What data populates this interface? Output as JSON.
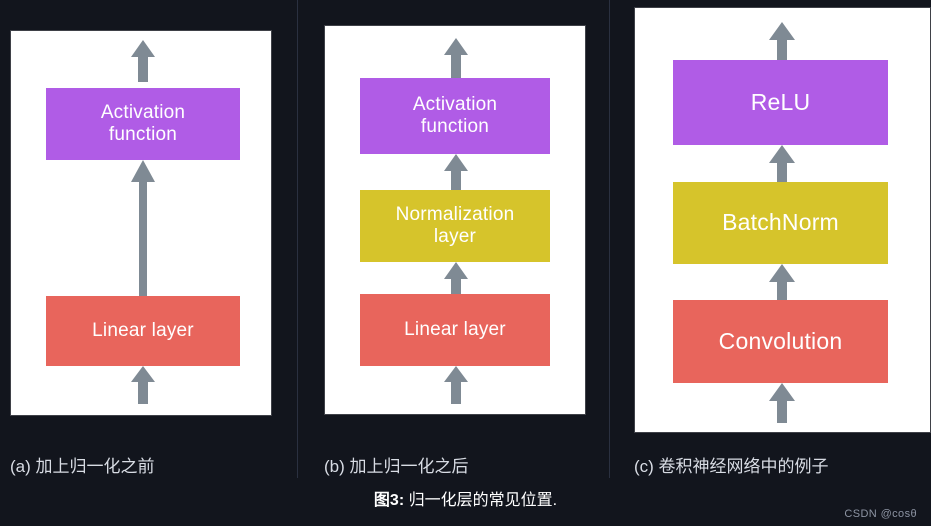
{
  "figure": {
    "caption_number": "图3:",
    "caption_text": " 归一化层的常见位置.",
    "watermark": "CSDN @cosθ"
  },
  "colors": {
    "background": "#12151d",
    "card": "#ffffff",
    "purple": "#b05ce6",
    "yellow": "#d6c42b",
    "red": "#e8655c",
    "arrow": "#7f8a94",
    "divider": "#2a3040",
    "label_text": "#d8dce4"
  },
  "panels": [
    {
      "id": "a",
      "label": "(a) 加上归一化之前",
      "nodes": [
        {
          "text": "Activation\nfunction",
          "color": "purple"
        },
        {
          "text": "Linear layer",
          "color": "red"
        }
      ]
    },
    {
      "id": "b",
      "label": "(b) 加上归一化之后",
      "nodes": [
        {
          "text": "Activation\nfunction",
          "color": "purple"
        },
        {
          "text": "Normalization\nlayer",
          "color": "yellow"
        },
        {
          "text": "Linear layer",
          "color": "red"
        }
      ]
    },
    {
      "id": "c",
      "label": "(c) 卷积神经网络中的例子",
      "nodes": [
        {
          "text": "ReLU",
          "color": "purple"
        },
        {
          "text": "BatchNorm",
          "color": "yellow"
        },
        {
          "text": "Convolution",
          "color": "red"
        }
      ]
    }
  ]
}
